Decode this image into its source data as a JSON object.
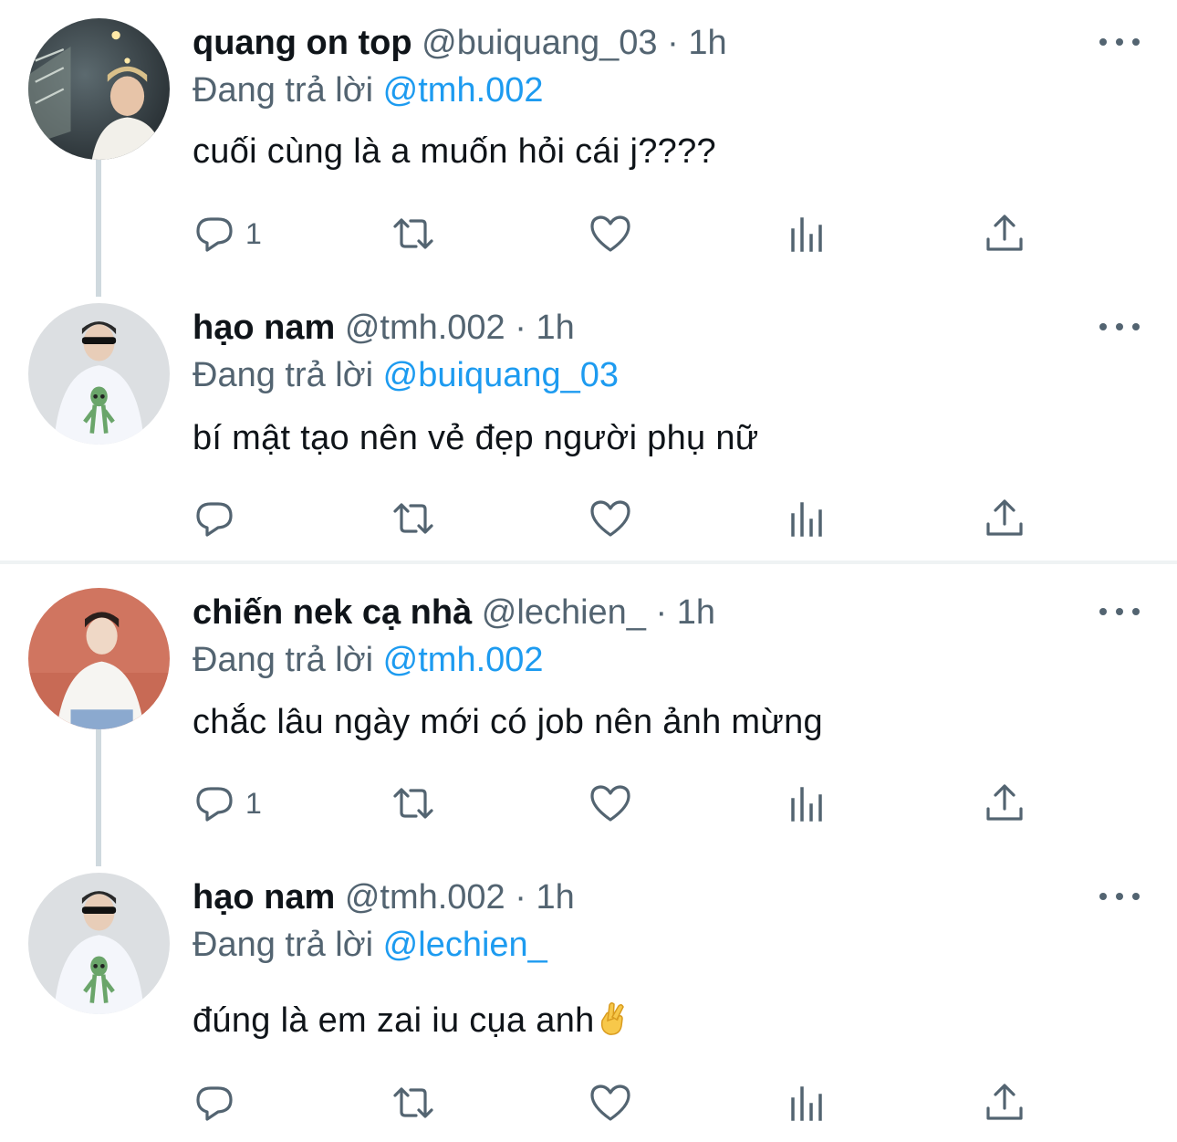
{
  "tweets": [
    {
      "name": "quang on top",
      "handle": "@buiquang_03",
      "sep": "·",
      "time": "1h",
      "reply_prefix": "Đang trả lời",
      "reply_to": "@tmh.002",
      "text": "cuối cùng là a muốn hỏi cái j????",
      "reply_count": "1",
      "avatar_icon": "avatar-bridge-photo"
    },
    {
      "name": "hạo nam",
      "handle": "@tmh.002",
      "sep": "·",
      "time": "1h",
      "reply_prefix": "Đang trả lời",
      "reply_to": "@buiquang_03",
      "text": "bí mật tạo nên vẻ đẹp người phụ nữ",
      "reply_count": "",
      "avatar_icon": "avatar-alien-shirt-photo"
    },
    {
      "name": "chiến nek cạ nhà",
      "handle": "@lechien_",
      "sep": "·",
      "time": "1h",
      "reply_prefix": "Đang trả lời",
      "reply_to": "@tmh.002",
      "text": "chắc lâu ngày mới có job nên ảnh mừng",
      "reply_count": "1",
      "avatar_icon": "avatar-red-wall-photo"
    },
    {
      "name": "hạo nam",
      "handle": "@tmh.002",
      "sep": "·",
      "time": "1h",
      "reply_prefix": "Đang trả lời",
      "reply_to": "@lechien_",
      "text": "đúng là em zai iu cụa anh",
      "text_emoji": "crossed-fingers",
      "reply_count": "",
      "avatar_icon": "avatar-alien-shirt-photo"
    }
  ],
  "colors": {
    "text": "#0f1419",
    "secondary": "#536471",
    "link": "#1d9bf0",
    "thread_line": "#cfd9de",
    "divider": "#eff3f4"
  },
  "icons": [
    "reply-icon",
    "retweet-icon",
    "like-icon",
    "views-icon",
    "share-icon",
    "more-icon"
  ]
}
